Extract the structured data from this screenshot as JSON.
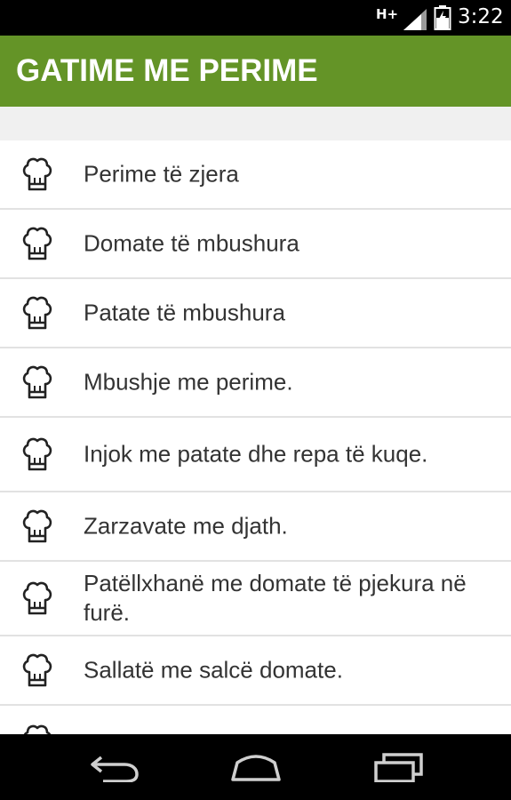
{
  "status": {
    "network": "H+",
    "time": "3:22"
  },
  "app": {
    "title": "GATIME ME PERIME"
  },
  "recipes": [
    "Perime të zjera",
    "Domate të mbushura",
    "Patate të mbushura",
    "Mbushje me perime.",
    "Injok me patate dhe repa të kuqe.",
    "Zarzavate me djath.",
    "Patëllxhanë me domate të pjekura në furë.",
    "Sallatë me salcë domate."
  ],
  "icons": {
    "list_item": "chef-hat-icon",
    "nav": [
      "back-icon",
      "home-icon",
      "recent-apps-icon"
    ],
    "status": [
      "signal-icon",
      "battery-icon"
    ]
  },
  "colors": {
    "app_bar": "#649427",
    "status_bar": "#000000",
    "text": "#333333"
  }
}
